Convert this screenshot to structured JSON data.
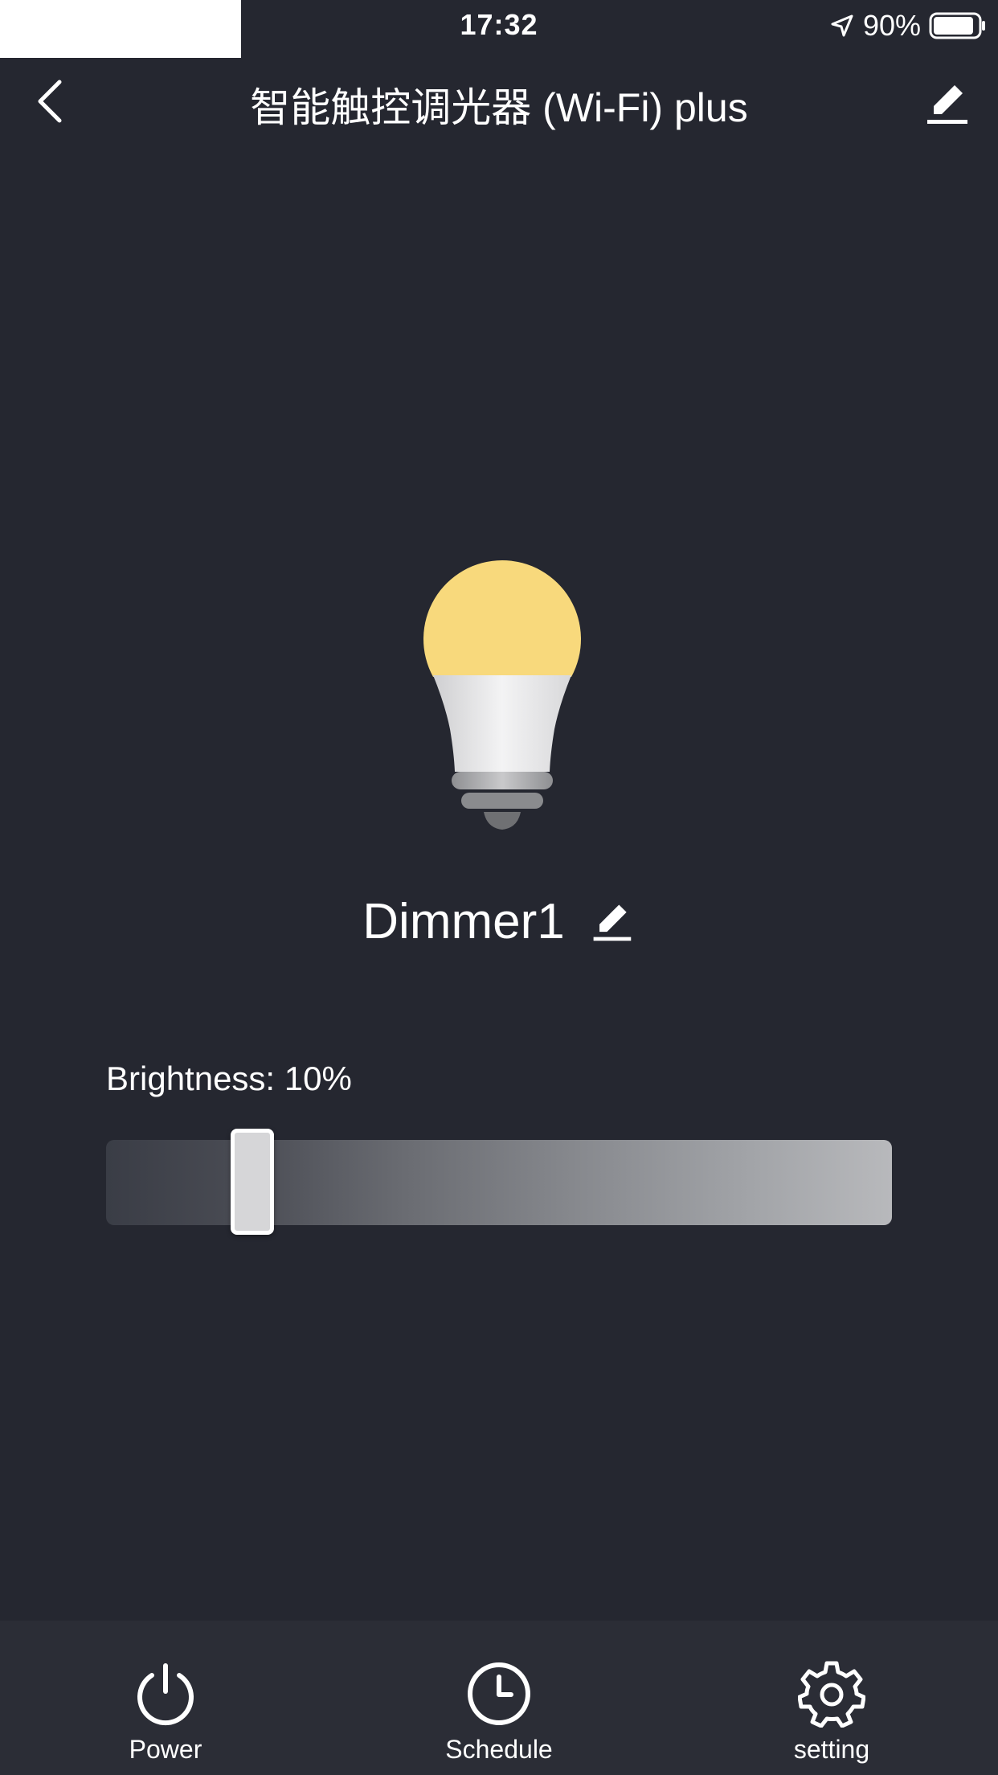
{
  "status_bar": {
    "time": "17:32",
    "battery_percent": "90%",
    "battery_level": 0.9
  },
  "header": {
    "title": "智能触控调光器 (Wi-Fi) plus"
  },
  "device": {
    "name": "Dimmer1"
  },
  "brightness": {
    "label": "Brightness: 10%",
    "value_percent": 10
  },
  "tabs": [
    {
      "label": "Power",
      "icon": "power-icon"
    },
    {
      "label": "Schedule",
      "icon": "clock-icon"
    },
    {
      "label": "setting",
      "icon": "gear-icon"
    }
  ],
  "colors": {
    "background": "#252730",
    "tab_bar": "#2b2d36",
    "bulb_glow": "#f8d97c",
    "text": "#ffffff"
  }
}
